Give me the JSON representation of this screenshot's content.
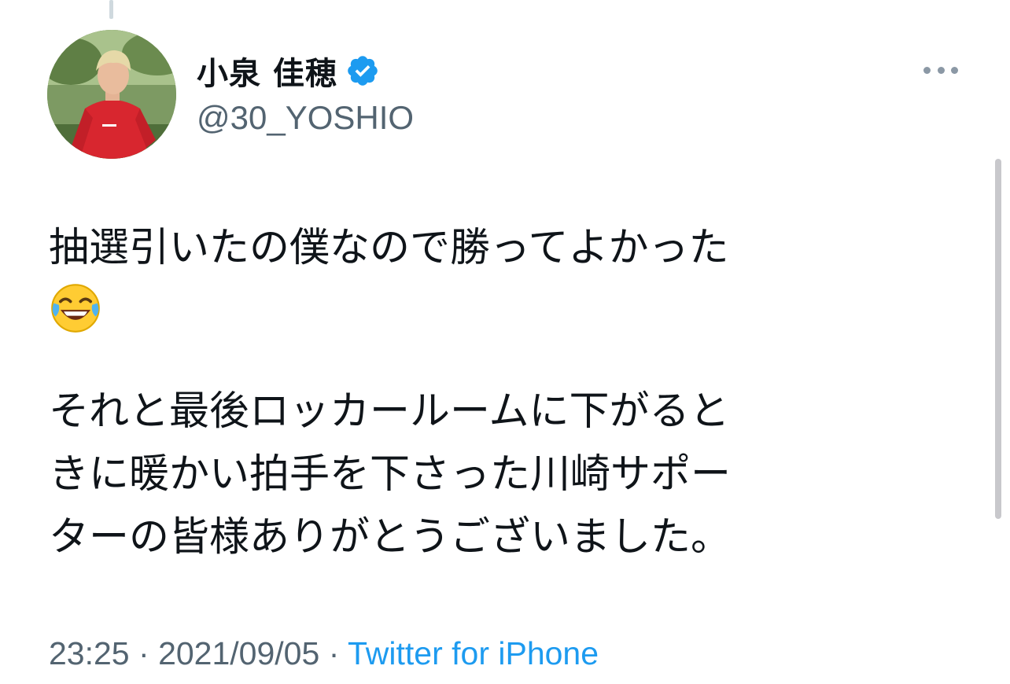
{
  "author": {
    "display_name": "小泉 佳穂",
    "handle": "@30_YOSHIO",
    "verified": true
  },
  "tweet": {
    "line1": "抽選引いたの僕なので勝ってよかった",
    "emoji": "face-with-tears-of-joy",
    "paragraph2": [
      "それと最後ロッカールームに下がると",
      "きに暖かい拍手を下さった川崎サポー",
      "ターの皆様ありがとうございました。"
    ]
  },
  "meta": {
    "time": "23:25",
    "separator": "·",
    "date": "2021/09/05",
    "source": "Twitter for iPhone"
  },
  "colors": {
    "text": "#0f1419",
    "secondary": "#536471",
    "link": "#1d9bf0",
    "verified": "#1d9bf0"
  }
}
